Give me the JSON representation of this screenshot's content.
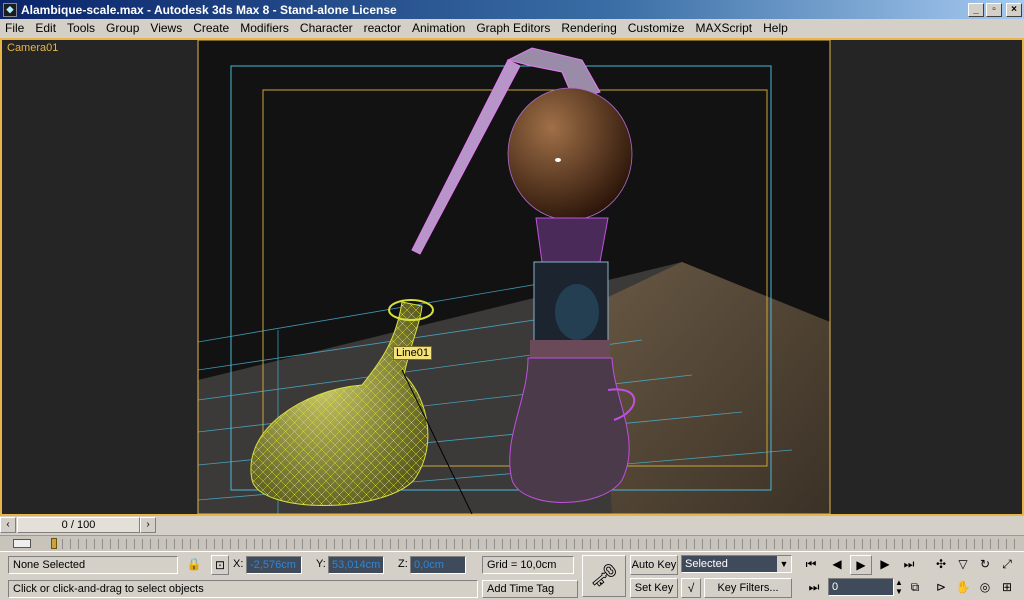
{
  "window": {
    "title": "Alambique-scale.max - Autodesk 3ds Max 8  - Stand-alone License"
  },
  "menu": [
    "File",
    "Edit",
    "Tools",
    "Group",
    "Views",
    "Create",
    "Modifiers",
    "Character",
    "reactor",
    "Animation",
    "Graph Editors",
    "Rendering",
    "Customize",
    "MAXScript",
    "Help"
  ],
  "viewport": {
    "label": "Camera01",
    "object_tag": "Line01"
  },
  "timeline": {
    "position": "0 / 100"
  },
  "status": {
    "selection": "None Selected",
    "prompt": "Click or click-and-drag to select objects",
    "x_label": "X:",
    "x_value": "-2,576cm",
    "y_label": "Y:",
    "y_value": "53,014cm",
    "z_label": "Z:",
    "z_value": "0,0cm",
    "grid": "Grid = 10,0cm",
    "add_time_tag": "Add Time Tag",
    "auto_key": "Auto Key",
    "set_key": "Set Key",
    "key_mode_value": "Selected",
    "key_filters": "Key Filters...",
    "frame_value": "0"
  },
  "icons": {
    "lock": "lock-icon",
    "key": "key-icon",
    "play": "play-icon"
  }
}
